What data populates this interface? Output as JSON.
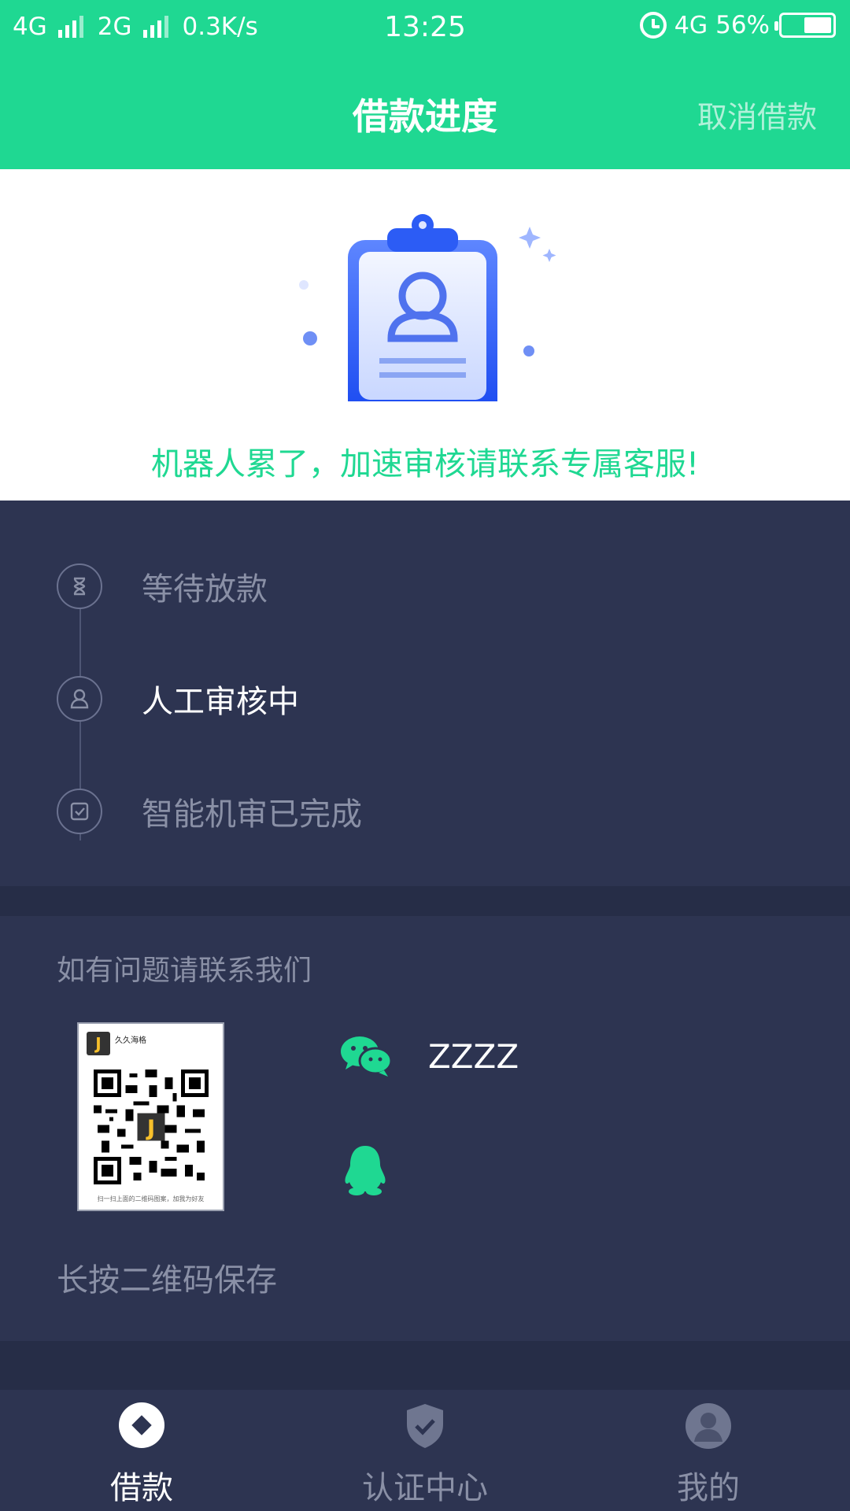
{
  "status_bar": {
    "network1": "4G",
    "network2": "2G",
    "speed": "0.3K/s",
    "time": "13:25",
    "network3": "4G",
    "battery": "56%",
    "battery_level": 0.56
  },
  "header": {
    "title": "借款进度",
    "action": "取消借款"
  },
  "banner": {
    "message": "机器人累了，加速审核请联系专属客服!"
  },
  "progress": {
    "steps": [
      {
        "label": "等待放款",
        "state": "pending",
        "icon": "hourglass-icon"
      },
      {
        "label": "人工审核中",
        "state": "current",
        "icon": "person-icon"
      },
      {
        "label": "智能机审已完成",
        "state": "done",
        "icon": "check-box-icon"
      }
    ]
  },
  "contact": {
    "title": "如有问题请联系我们",
    "qr_brand_letter": "J",
    "qr_brand_name": "久久海格",
    "qr_caption": "扫一扫上面的二维码图案，加我为好友",
    "wechat_id": "ZZZZ",
    "save_hint": "长按二维码保存"
  },
  "tabs": [
    {
      "label": "借款",
      "active": true,
      "icon": "loan-icon"
    },
    {
      "label": "认证中心",
      "active": false,
      "icon": "shield-check-icon"
    },
    {
      "label": "我的",
      "active": false,
      "icon": "profile-icon"
    }
  ],
  "colors": {
    "brand": "#1fd892",
    "panel": "#2d3451",
    "muted_text": "#8a90a6"
  }
}
